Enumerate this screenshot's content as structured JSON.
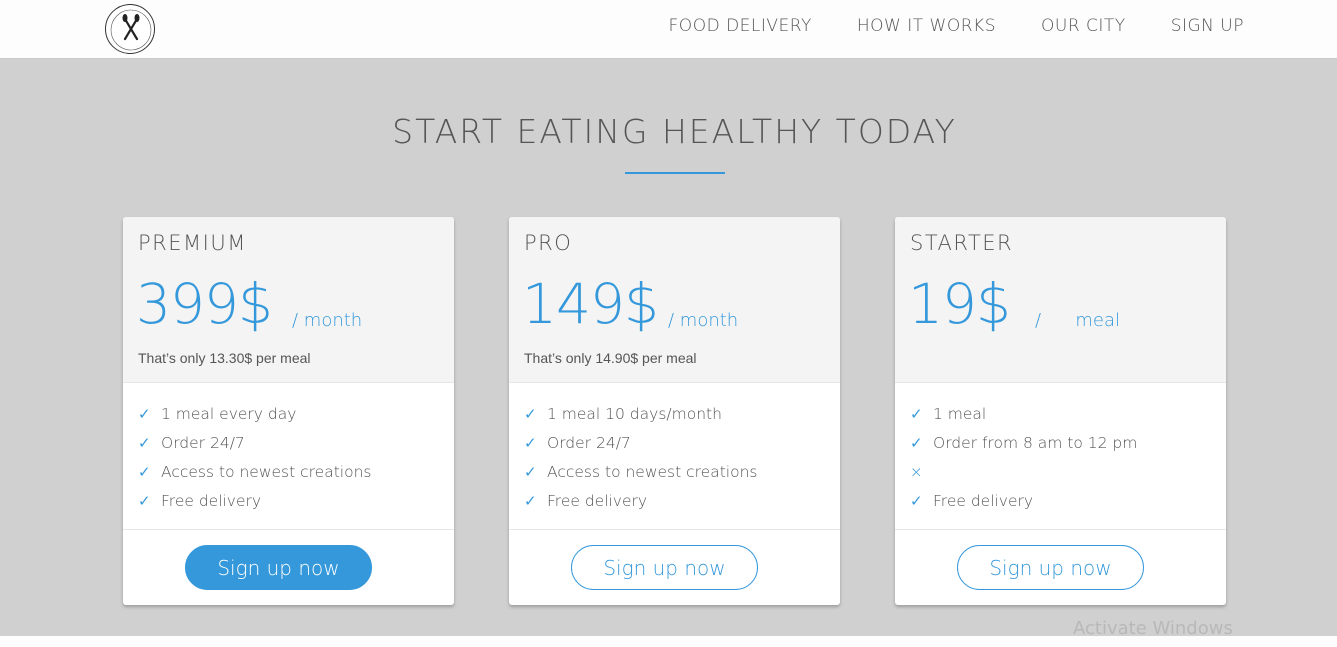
{
  "nav": {
    "links": [
      "FOOD DELIVERY",
      "HOW IT WORKS",
      "OUR CITY",
      "SIGN UP"
    ]
  },
  "section": {
    "title": "START EATING HEALTHY TODAY"
  },
  "plans": [
    {
      "name": "PREMIUM",
      "price": "399$",
      "per": "/ month",
      "meal_note": "That’s only 13.30$ per meal",
      "features": [
        {
          "icon": "check-icon",
          "glyph": "✓",
          "text": "1 meal every day"
        },
        {
          "icon": "check-icon",
          "glyph": "✓",
          "text": "Order 24/7"
        },
        {
          "icon": "check-icon",
          "glyph": "✓",
          "text": "Access to newest creations"
        },
        {
          "icon": "check-icon",
          "glyph": "✓",
          "text": "Free delivery"
        }
      ],
      "button": "Sign up now"
    },
    {
      "name": "PRO",
      "price": "149$",
      "per": "/ month",
      "meal_note": "That’s only 14.90$ per meal",
      "features": [
        {
          "icon": "check-icon",
          "glyph": "✓",
          "text": "1 meal 10 days/month"
        },
        {
          "icon": "check-icon",
          "glyph": "✓",
          "text": "Order 24/7"
        },
        {
          "icon": "check-icon",
          "glyph": "✓",
          "text": "Access to newest creations"
        },
        {
          "icon": "check-icon",
          "glyph": "✓",
          "text": "Free delivery"
        }
      ],
      "button": "Sign up now"
    },
    {
      "name": "STARTER",
      "price": "19$",
      "per": "/      meal",
      "meal_note": "",
      "features": [
        {
          "icon": "check-icon",
          "glyph": "✓",
          "text": "1 meal"
        },
        {
          "icon": "check-icon",
          "glyph": "✓",
          "text": "Order from 8 am to 12 pm"
        },
        {
          "icon": "cross-icon",
          "glyph": "×",
          "text": ""
        },
        {
          "icon": "check-icon",
          "glyph": "✓",
          "text": "Free delivery"
        }
      ],
      "button": "Sign up now"
    }
  ],
  "watermark": "Activate Windows",
  "colors": {
    "accent": "#3498db",
    "background": "#d0d0d0",
    "card": "#ffffff",
    "card_head": "#f4f4f4"
  }
}
